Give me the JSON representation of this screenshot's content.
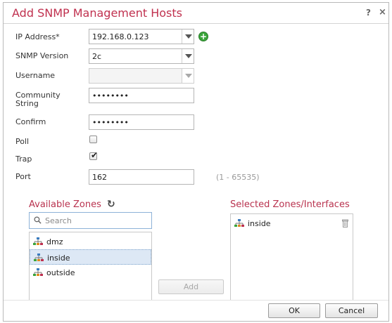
{
  "dialog": {
    "title": "Add SNMP Management Hosts",
    "help_label": "?",
    "close_label": "×"
  },
  "form": {
    "ip_address": {
      "label": "IP Address*",
      "value": "192.168.0.123"
    },
    "snmp_version": {
      "label": "SNMP Version",
      "value": "2c"
    },
    "username": {
      "label": "Username",
      "value": ""
    },
    "community_string": {
      "label_line1": "Community",
      "label_line2": "String",
      "value": "••••••••"
    },
    "confirm": {
      "label": "Confirm",
      "value": "••••••••"
    },
    "poll": {
      "label": "Poll",
      "checked": false
    },
    "trap": {
      "label": "Trap",
      "checked": true
    },
    "port": {
      "label": "Port",
      "value": "162",
      "hint": "(1 - 65535)"
    }
  },
  "available_zones": {
    "title": "Available Zones",
    "refresh_icon": "refresh-icon",
    "search_placeholder": "Search",
    "items": [
      {
        "label": "dmz",
        "selected": false
      },
      {
        "label": "inside",
        "selected": true
      },
      {
        "label": "outside",
        "selected": false
      }
    ]
  },
  "add_button": {
    "label": "Add",
    "enabled": false
  },
  "selected_zones": {
    "title": "Selected Zones/Interfaces",
    "items": [
      {
        "label": "inside"
      }
    ]
  },
  "footer": {
    "ok_label": "OK",
    "cancel_label": "Cancel"
  },
  "colors": {
    "title": "#c0314f",
    "section_title": "#b9334f",
    "add_icon": "#3aa53a",
    "selection": "#dde8f5"
  }
}
